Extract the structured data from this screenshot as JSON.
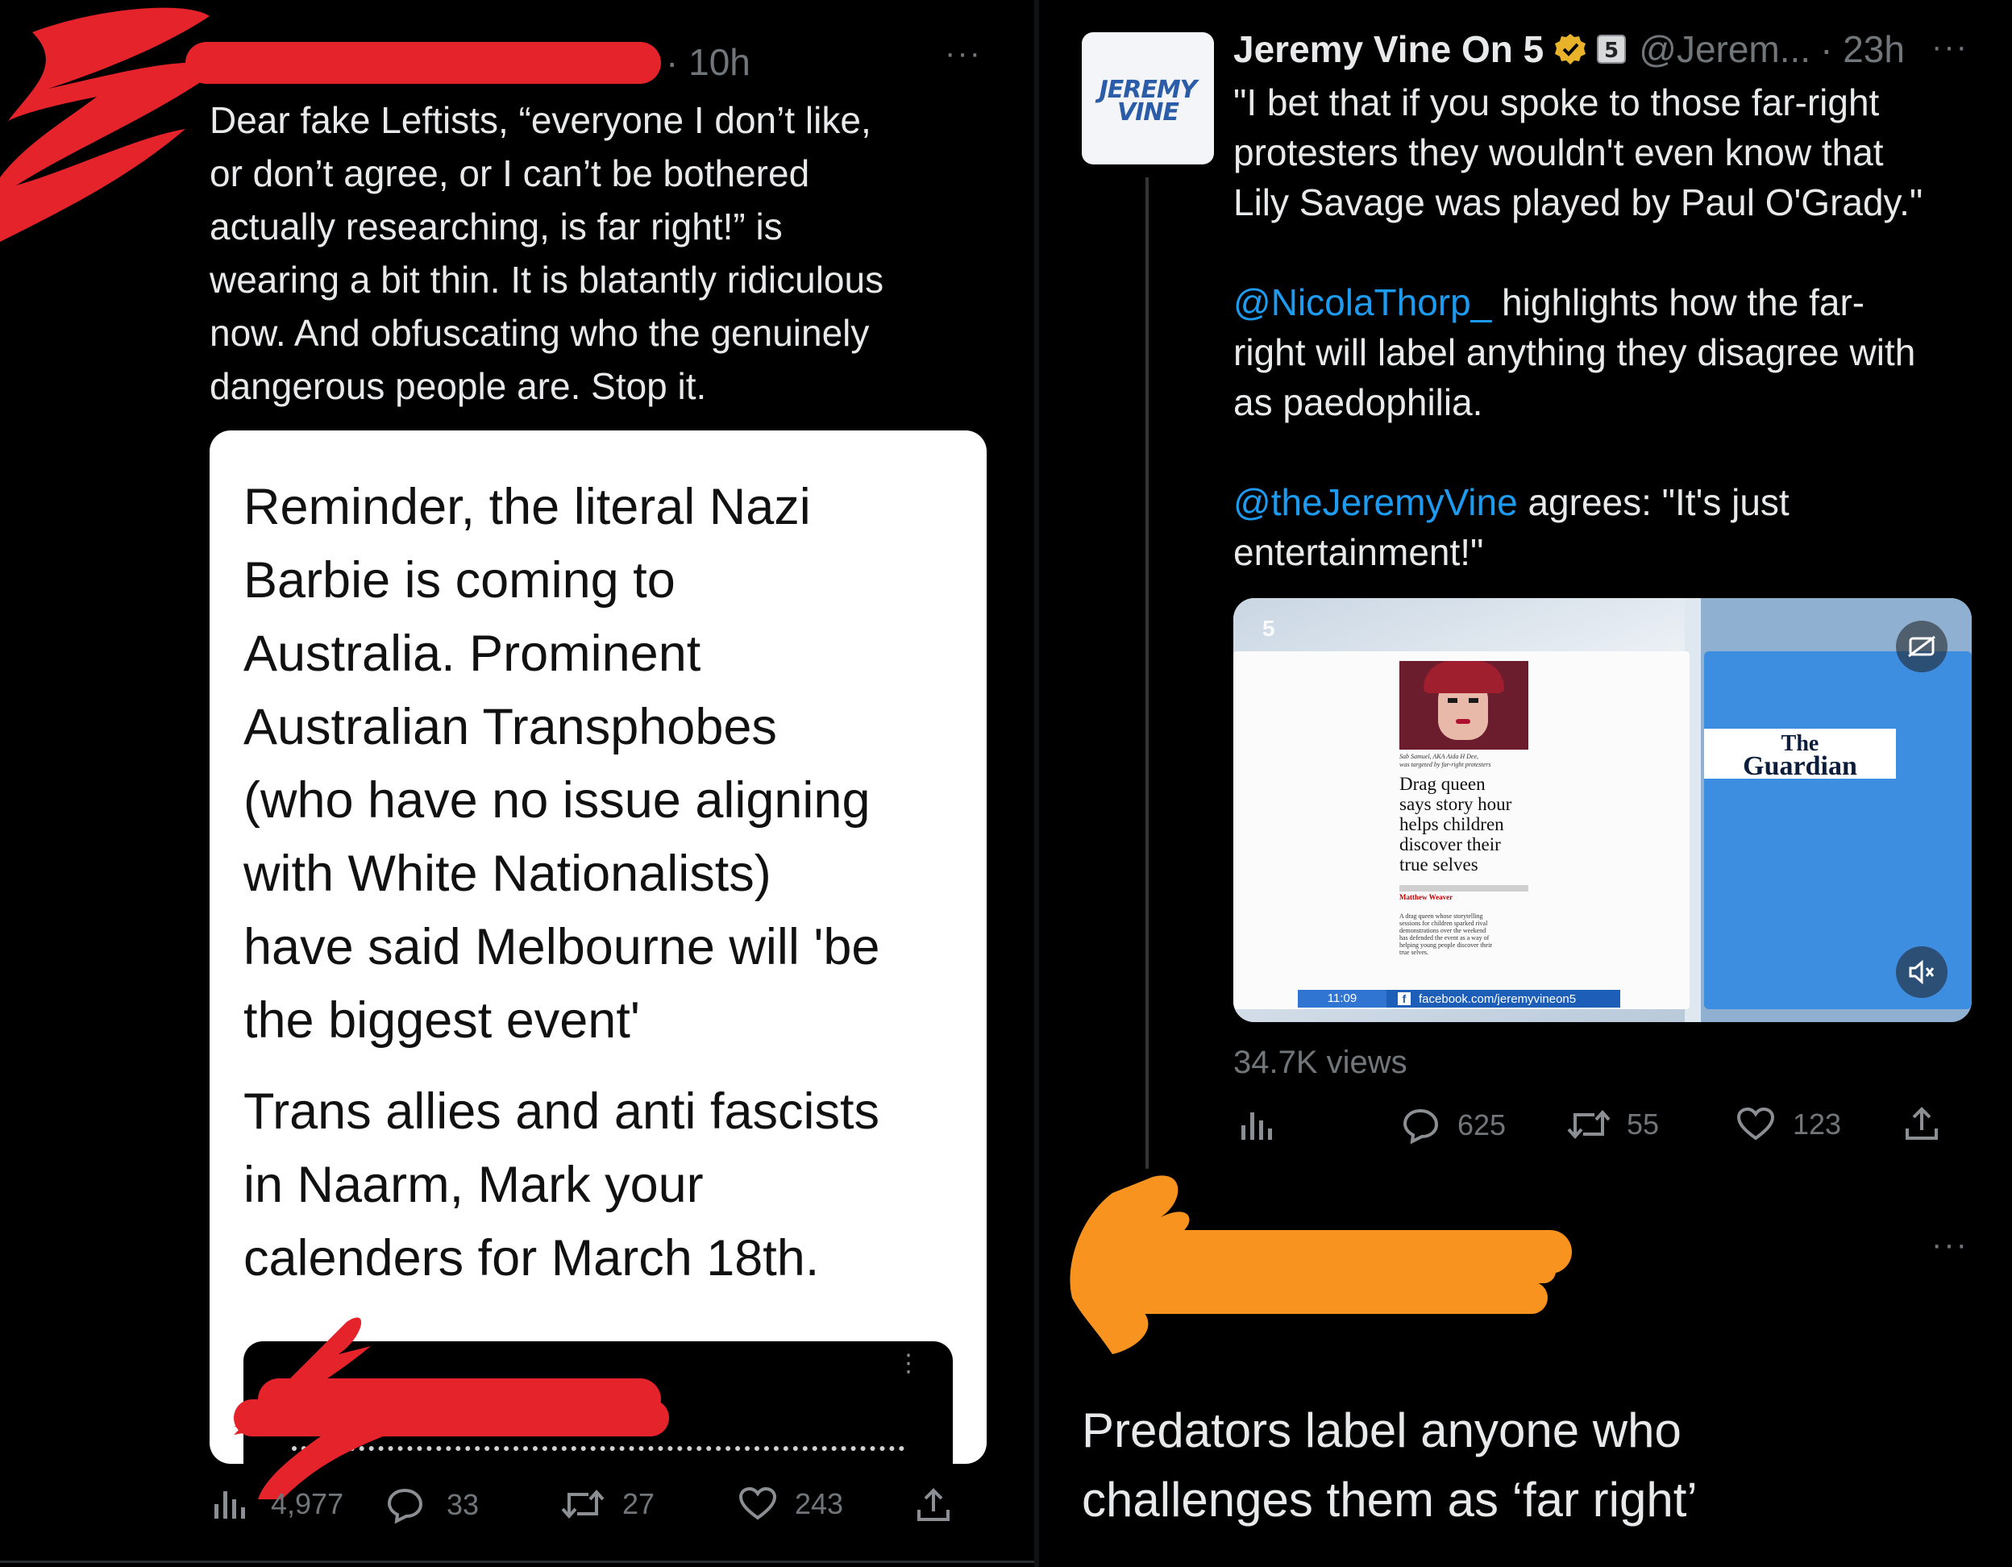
{
  "left_tweet": {
    "time": "10h",
    "body": "Dear fake Leftists, “everyone I don’t like,\nor don’t agree, or I can’t be bothered\nactually researching, is far right!” is\nwearing a bit thin. It is blatantly ridiculous\nnow. And obfuscating who the genuinely\ndangerous people are. Stop it.",
    "quoted_image": {
      "paragraph1": "Reminder, the literal Nazi\nBarbie is coming to\nAustralia. Prominent\nAustralian Transphobes\n(who have no issue aligning\nwith White Nationalists)\nhave said Melbourne will 'be\nthe biggest event'",
      "paragraph2": "Trans allies and anti fascists\nin Naarm, Mark your\ncalenders for March 18th."
    },
    "actions": {
      "views": "4,977",
      "replies": "33",
      "retweets": "27",
      "likes": "243"
    }
  },
  "right_tweet": {
    "logo_line1": "JEREMY",
    "logo_line2": "VINE",
    "display_name": "Jeremy Vine On 5",
    "handle": "@Jerem...",
    "time": "· 23h",
    "body_quote": "\"I bet that if you spoke to those far-right\nprotesters they wouldn't even know that\nLily Savage was played by Paul O'Grady.\"",
    "mention1": "@NicolaThorp_",
    "body_p2_after": " highlights how the far-",
    "body_p2_rest": "right will label anything they disagree with\nas paedophilia.",
    "mention2": "@theJeremyVine",
    "body_p3_after": " agrees: \"It's just",
    "body_p3_rest": "entertainment!\"",
    "video": {
      "channel_badge": "5",
      "headline": "Drag queen\nsays story hour\nhelps children\ndiscover their\ntrue selves",
      "caption": "Sab Samuel, AKA Aida H Dee,\nwas targeted by far-right protesters",
      "byline": "Matthew Weaver",
      "article_text": "A drag queen whose storytelling\nsessions for children sparked rival\ndemonstrations over the weekend\nhas defended the event as a way of\nhelping young people discover their\ntrue selves.",
      "guardian_line1": "The",
      "guardian_line2": "Guardian",
      "clock": "11:09",
      "facebook_url": "facebook.com/jeremyvineon5"
    },
    "views": "34.7K views",
    "actions": {
      "replies": "625",
      "retweets": "55",
      "likes": "123"
    }
  },
  "reply_tweet": {
    "body": "Predators label anyone who\nchallenges them as ‘far right’"
  },
  "colors": {
    "background": "#000000",
    "text": "#e7e9ea",
    "muted": "#71767b",
    "link": "#1d9bf0",
    "redaction_red": "#e5232a",
    "redaction_orange": "#f7931e",
    "verified_gold": "#e8b32a"
  }
}
